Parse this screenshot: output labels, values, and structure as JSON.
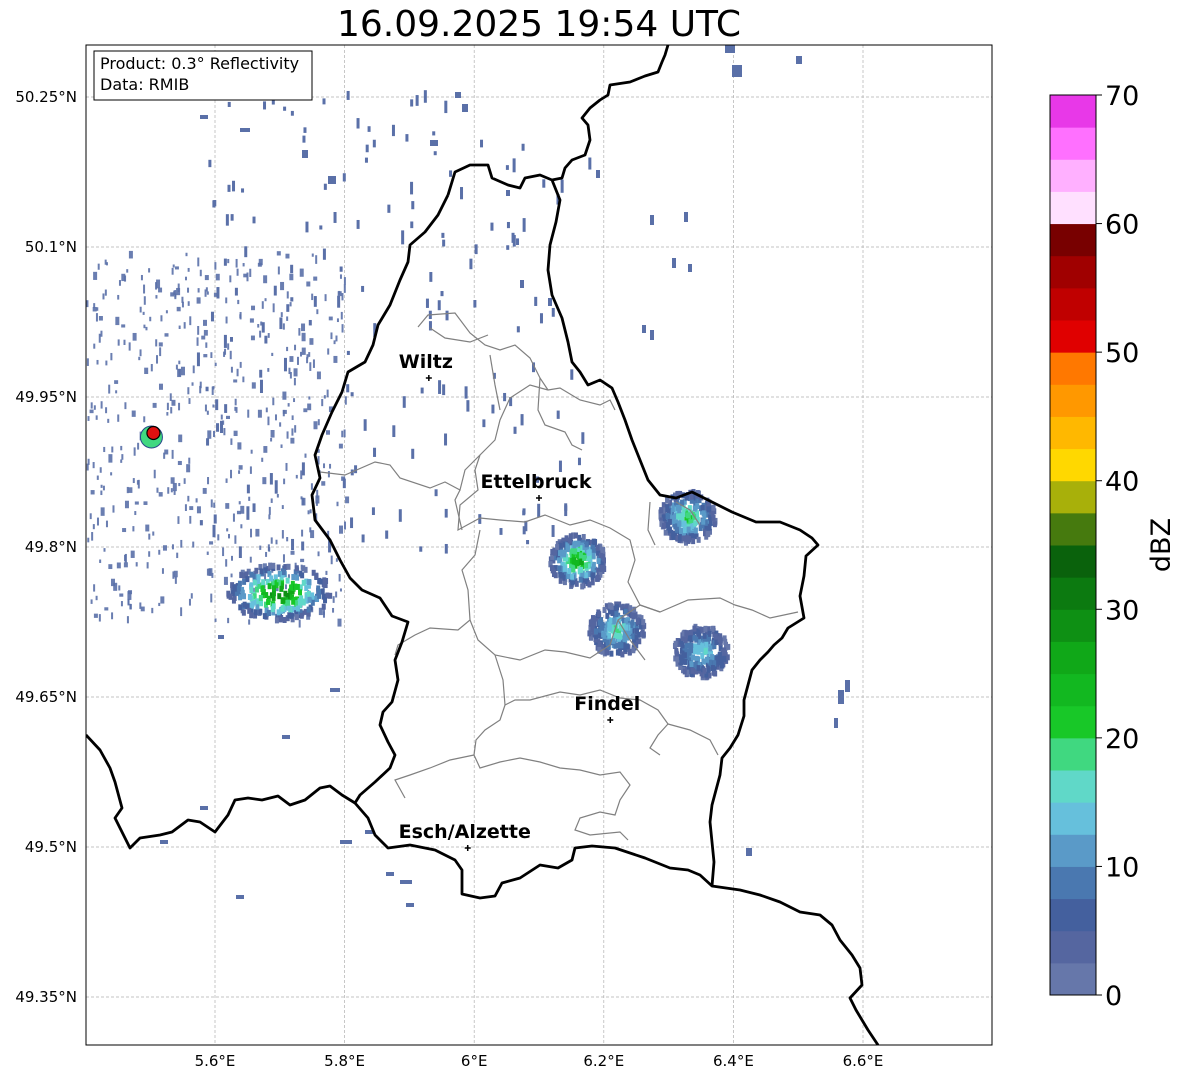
{
  "title": "16.09.2025 19:54 UTC",
  "info_box": {
    "product": "Product: 0.3° Reflectivity",
    "data": "Data: RMIB"
  },
  "x_ticks": [
    "5.6°E",
    "5.8°E",
    "6°E",
    "6.2°E",
    "6.4°E",
    "6.6°E"
  ],
  "y_ticks": [
    "50.25°N",
    "50.1°N",
    "49.95°N",
    "49.8°N",
    "49.65°N",
    "49.5°N",
    "49.35°N"
  ],
  "cities": [
    {
      "name": "Wiltz",
      "lon": 5.93,
      "lat": 49.969
    },
    {
      "name": "Ettelbruck",
      "lon": 6.1,
      "lat": 49.849
    },
    {
      "name": "Findel",
      "lon": 6.21,
      "lat": 49.627
    },
    {
      "name": "Esch/Alzette",
      "lon": 5.99,
      "lat": 49.499
    }
  ],
  "radar_site": {
    "lon": 5.505,
    "lat": 49.914
  },
  "colorbar": {
    "label": "dBZ",
    "ticks": [
      "0",
      "10",
      "20",
      "30",
      "40",
      "50",
      "60",
      "70"
    ],
    "min": 0,
    "max": 70,
    "step": 2.5,
    "colors": [
      "#6677aa",
      "#5566a0",
      "#44609e",
      "#4a78b0",
      "#5a9ac8",
      "#66c0dc",
      "#60d8c8",
      "#40d880",
      "#18c828",
      "#12b820",
      "#10a818",
      "#0e9014",
      "#0c7a10",
      "#0a620c",
      "#467a0e",
      "#a8b00a",
      "#ffd800",
      "#ffb800",
      "#ff9800",
      "#ff7800",
      "#e00000",
      "#c00000",
      "#a00000",
      "#780000",
      "#ffe0ff",
      "#ffb0ff",
      "#ff70ff",
      "#e838e8"
    ]
  },
  "precip_cells": [
    {
      "name": "west-cluster",
      "lon": 5.7,
      "lat": 49.754,
      "peak_dbz": 30
    },
    {
      "name": "cell-center",
      "lon": 6.16,
      "lat": 49.786,
      "peak_dbz": 25
    },
    {
      "name": "cell-east-north",
      "lon": 6.33,
      "lat": 49.83,
      "peak_dbz": 20
    },
    {
      "name": "cell-south-center",
      "lon": 6.22,
      "lat": 49.717,
      "peak_dbz": 17
    },
    {
      "name": "cell-east-south",
      "lon": 6.35,
      "lat": 49.695,
      "peak_dbz": 15
    }
  ]
}
